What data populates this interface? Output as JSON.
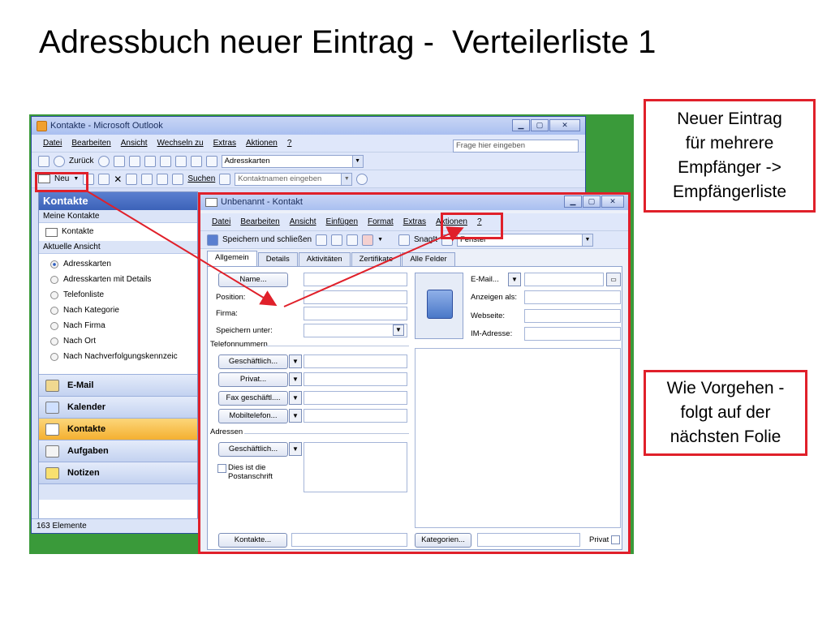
{
  "slide": {
    "title": "Adressbuch neuer Eintrag -  Verteilerliste 1",
    "callout_top": "Neuer Eintrag\nfür mehrere\nEmpfänger ->\nEmpfängerliste",
    "callout_bottom": "Wie Vorgehen -\nfolgt auf der\nnächsten Folie",
    "highlight_color": "#e0202a"
  },
  "outlook": {
    "window_title": "Kontakte - Microsoft Outlook",
    "menu": [
      "Datei",
      "Bearbeiten",
      "Ansicht",
      "Wechseln zu",
      "Extras",
      "Aktionen",
      "?"
    ],
    "help_placeholder": "Frage hier eingeben",
    "toolbar1": {
      "back_label": "Zurück",
      "view_combo": "Adresskarten"
    },
    "toolbar2": {
      "new_label": "Neu",
      "search_label": "Suchen",
      "contact_search_placeholder": "Kontaktnamen eingeben"
    },
    "nav": {
      "header": "Kontakte",
      "my_contacts_label": "Meine Kontakte",
      "contacts_folder": "Kontakte",
      "current_view_label": "Aktuelle Ansicht",
      "views": [
        "Adresskarten",
        "Adresskarten mit Details",
        "Telefonliste",
        "Nach Kategorie",
        "Nach Firma",
        "Nach Ort",
        "Nach Nachverfolgungskennzeic"
      ],
      "selected_view_index": 0,
      "buttons": [
        {
          "label": "E-Mail",
          "icon": "mail-icon"
        },
        {
          "label": "Kalender",
          "icon": "calendar-icon"
        },
        {
          "label": "Kontakte",
          "icon": "contacts-icon"
        },
        {
          "label": "Aufgaben",
          "icon": "tasks-icon"
        },
        {
          "label": "Notizen",
          "icon": "notes-icon"
        }
      ],
      "active_button": "Kontakte"
    },
    "status": "163 Elemente"
  },
  "contact_form": {
    "window_title": "Unbenannt - Kontakt",
    "menu": [
      "Datei",
      "Bearbeiten",
      "Ansicht",
      "Einfügen",
      "Format",
      "Extras",
      "Aktionen",
      "?"
    ],
    "save_close_label": "Speichern und schließen",
    "snagit_label": "SnagIt",
    "window_combo": "Fenster",
    "tabs": [
      "Allgemein",
      "Details",
      "Aktivitäten",
      "Zertifikate",
      "Alle Felder"
    ],
    "selected_tab": "Allgemein",
    "left_fields": {
      "name_button": "Name...",
      "position_label": "Position:",
      "company_label": "Firma:",
      "save_as_label": "Speichern unter:"
    },
    "phone_group": "Telefonnummern",
    "phone_buttons": [
      "Geschäftlich...",
      "Privat...",
      "Fax geschäftl....",
      "Mobiltelefon..."
    ],
    "address_group": "Adressen",
    "address_button": "Geschäftlich...",
    "postal_checkbox": "Dies ist die\nPostanschrift",
    "right_fields": {
      "email_label": "E-Mail...",
      "display_as_label": "Anzeigen als:",
      "website_label": "Webseite:",
      "im_label": "IM-Adresse:"
    },
    "contacts_button": "Kontakte...",
    "categories_button": "Kategorien...",
    "private_label": "Privat"
  }
}
